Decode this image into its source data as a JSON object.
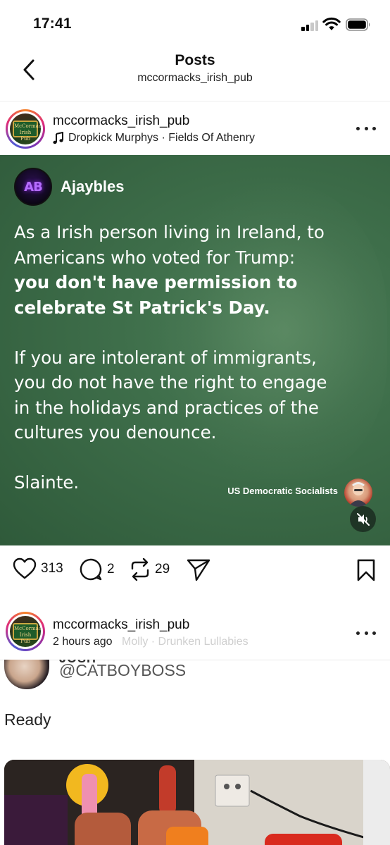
{
  "status_bar": {
    "time": "17:41"
  },
  "nav": {
    "title": "Posts",
    "subtitle": "mccormacks_irish_pub"
  },
  "post1": {
    "username": "mccormacks_irish_pub",
    "music": "Dropkick Murphys · Fields Of Athenry",
    "media": {
      "author": "Ajaybles",
      "paragraph1_line1": "As a Irish person living in Ireland, to",
      "paragraph1_line2": "Americans who voted for Trump:",
      "paragraph1_bold1": "you don't have permission to",
      "paragraph1_bold2": "celebrate St Patrick's Day.",
      "paragraph2_line1": "If you are intolerant of immigrants,",
      "paragraph2_line2": "you do not have the right to engage",
      "paragraph2_line3": "in the holidays and practices of the",
      "paragraph2_line4": "cultures you denounce.",
      "sign_off": "Slainte.",
      "source": "US Democratic Socialists"
    },
    "likes": "313",
    "comments": "2",
    "reposts": "29"
  },
  "post2": {
    "username": "mccormacks_irish_pub",
    "time": "2 hours ago",
    "music_faded": "Molly · Drunken Lullabies",
    "embedded": {
      "clipped_name": "JOSH",
      "handle": "@CATBOYBOSS",
      "text": "Ready"
    }
  },
  "colors": {
    "media_green": "#3e6e4a",
    "text": "#111111",
    "link_gray": "#555555"
  }
}
